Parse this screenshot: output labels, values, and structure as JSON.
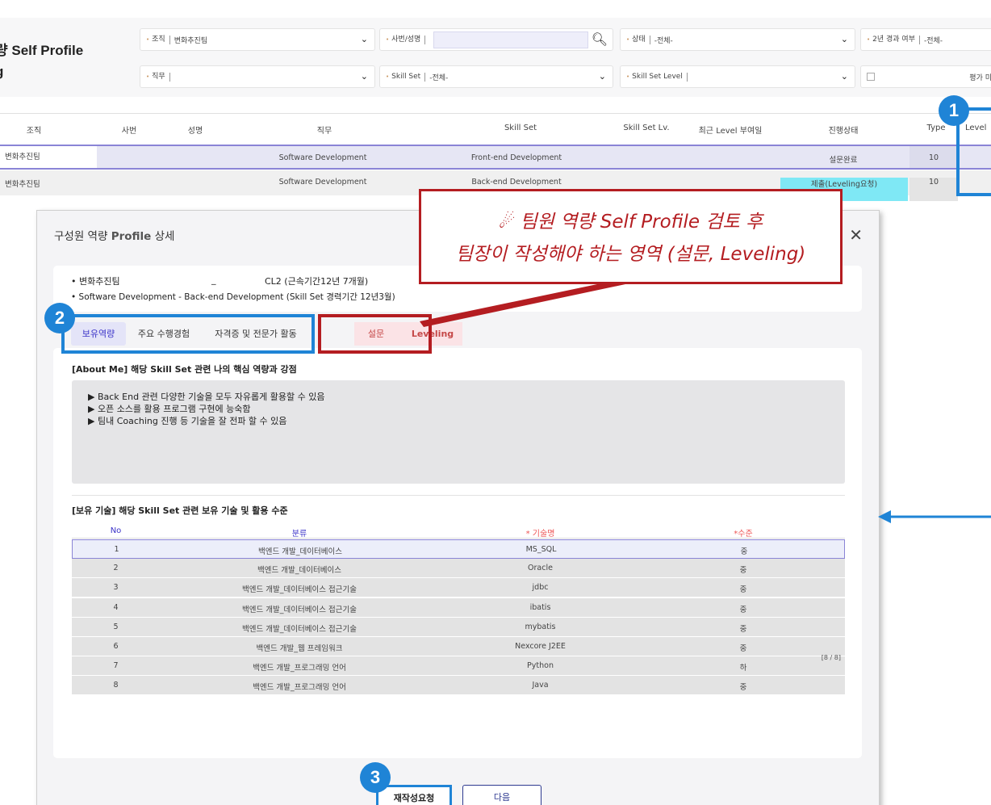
{
  "page": {
    "title_line1": "량 Self Profile",
    "title_line2": "g"
  },
  "filters": {
    "org_label": "조직",
    "org_value": "변화추진팀",
    "emp_label": "사번/성명",
    "status_label": "상태",
    "status_value": "-전체-",
    "twoyear_label": "2년 경과 여부",
    "twoyear_value": "-전체-",
    "job_label": "직무",
    "job_value": "",
    "skillset_label": "Skill Set",
    "skillset_value": "-전체-",
    "skilllevel_label": "Skill Set Level",
    "skilllevel_value": "",
    "eval_label": "평가 미"
  },
  "grid": {
    "headers": [
      "조직",
      "사번",
      "성명",
      "직무",
      "Skill Set",
      "Skill Set Lv.",
      "최근 Level 부여일",
      "진행상태",
      "Type",
      "Level"
    ],
    "rows": [
      {
        "org": "변화추진팀",
        "job": "Software Development",
        "skillset": "Front-end Development",
        "status": "설문완료",
        "type": "10"
      },
      {
        "org": "변화추진팀",
        "job": "Software Development",
        "skillset": "Back-end Development",
        "status": "제출(Leveling요청)",
        "type": "10"
      }
    ]
  },
  "modal": {
    "title_prefix": "구성원 역량 ",
    "title_bold": "Profile",
    "title_suffix": " 상세",
    "info_org": "• 변화추진팀",
    "info_dash": "_",
    "info_grade": "CL2 (근속기간12년 7개월)",
    "info_skill": "• Software Development  -  Back-end Development (Skill Set 경력기간 12년3월)",
    "tabs": [
      "보유역량",
      "주요 수행경험",
      "자격증 및 전문가 활동",
      "설문",
      "Leveling"
    ],
    "about_title": "[About Me] 해당 Skill Set 관련 나의 핵심 역량과 강점",
    "about_lines": [
      "▶ Back End 관련 다양한 기술을 모두 자유롭게 활용할 수 있음",
      "▶ 오픈 소스를 활용 프로그램 구현에 능숙함",
      "▶ 팀내 Coaching 진행 등 기술을 잘 전파 할 수 있음"
    ],
    "skills_title": "[보유 기술] 해당 Skill Set 관련 보유 기술 및 활용 수준",
    "skills_headers": [
      "No",
      "분류",
      "* 기술명",
      "*수준"
    ],
    "skills": [
      {
        "no": "1",
        "cat": "백엔드 개발_데이터베이스",
        "name": "MS_SQL",
        "level": "중"
      },
      {
        "no": "2",
        "cat": "백엔드 개발_데이터베이스",
        "name": "Oracle",
        "level": "중"
      },
      {
        "no": "3",
        "cat": "백엔드 개발_데이터베이스 접근기술",
        "name": "jdbc",
        "level": "중"
      },
      {
        "no": "4",
        "cat": "백엔드 개발_데이터베이스 접근기술",
        "name": "ibatis",
        "level": "중"
      },
      {
        "no": "5",
        "cat": "백엔드 개발_데이터베이스 접근기술",
        "name": "mybatis",
        "level": "중"
      },
      {
        "no": "6",
        "cat": "백엔드 개발_웹 프레임워크",
        "name": "Nexcore J2EE",
        "level": "중"
      },
      {
        "no": "7",
        "cat": "백엔드 개발_프로그래밍 언어",
        "name": "Python",
        "level": "하"
      },
      {
        "no": "8",
        "cat": "백엔드 개발_프로그래밍 언어",
        "name": "Java",
        "level": "중"
      }
    ],
    "pager": "[8 / 8]",
    "btn_rewrite": "재작성요청",
    "btn_next": "다음"
  },
  "annotations": {
    "badge1": "1",
    "badge2": "2",
    "badge3": "3",
    "callout_line1": "팀원 역량 Self Profile 검토 후",
    "callout_line2": "팀장이 작성해야 하는 영역 (설문, Leveling)",
    "accent_blue": "#1f84d6",
    "accent_red": "#b41d21"
  }
}
